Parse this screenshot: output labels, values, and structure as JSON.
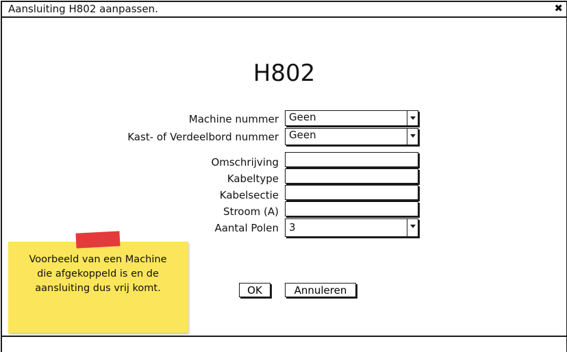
{
  "window": {
    "title": "Aansluiting H802 aanpassen."
  },
  "form": {
    "heading": "H802",
    "machine_label": "Machine nummer",
    "machine_value": "Geen",
    "kast_label": "Kast- of Verdeelbord nummer",
    "kast_value": "Geen",
    "omschrijving_label": "Omschrijving",
    "omschrijving_value": "",
    "kabeltype_label": "Kabeltype",
    "kabeltype_value": "",
    "kabelsectie_label": "Kabelsectie",
    "kabelsectie_value": "",
    "stroom_label": "Stroom (A)",
    "stroom_value": "",
    "polen_label": "Aantal Polen",
    "polen_value": "3"
  },
  "buttons": {
    "ok_label": "OK",
    "cancel_label": "Annuleren"
  },
  "note": {
    "text": "Voorbeeld van een Machine\ndie afgekoppeld is en de\naansluiting dus vrij komt.",
    "color": "#fbe55a",
    "tape_color": "#e33b3b"
  },
  "icons": {
    "close": "close-icon",
    "dropdown": "chevron-down-icon"
  }
}
